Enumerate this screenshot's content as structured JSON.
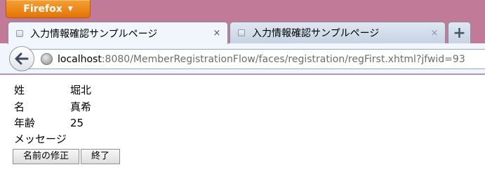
{
  "app": {
    "menu_button_label": "Firefox"
  },
  "tabs": [
    {
      "title": "入力情報確認サンプルページ",
      "close": "×"
    },
    {
      "title": "入力情報確認サンプルページ",
      "close": "×"
    }
  ],
  "new_tab_label": "+",
  "navigation": {
    "url_host": "localhost",
    "url_rest": ":8080/MemberRegistrationFlow/faces/registration/regFirst.xhtml?jfwid=93"
  },
  "form": {
    "rows": [
      {
        "label": "姓",
        "value": "堀北"
      },
      {
        "label": "名",
        "value": "真希"
      },
      {
        "label": "年齢",
        "value": "25"
      },
      {
        "label": "メッセージ",
        "value": ""
      }
    ],
    "buttons": {
      "edit_label": "名前の修正",
      "exit_label": "終了"
    }
  },
  "colors": {
    "window_background": "#c27a99",
    "firefox_button": "#e27408",
    "toolbar_background": "#f1f6fc"
  }
}
